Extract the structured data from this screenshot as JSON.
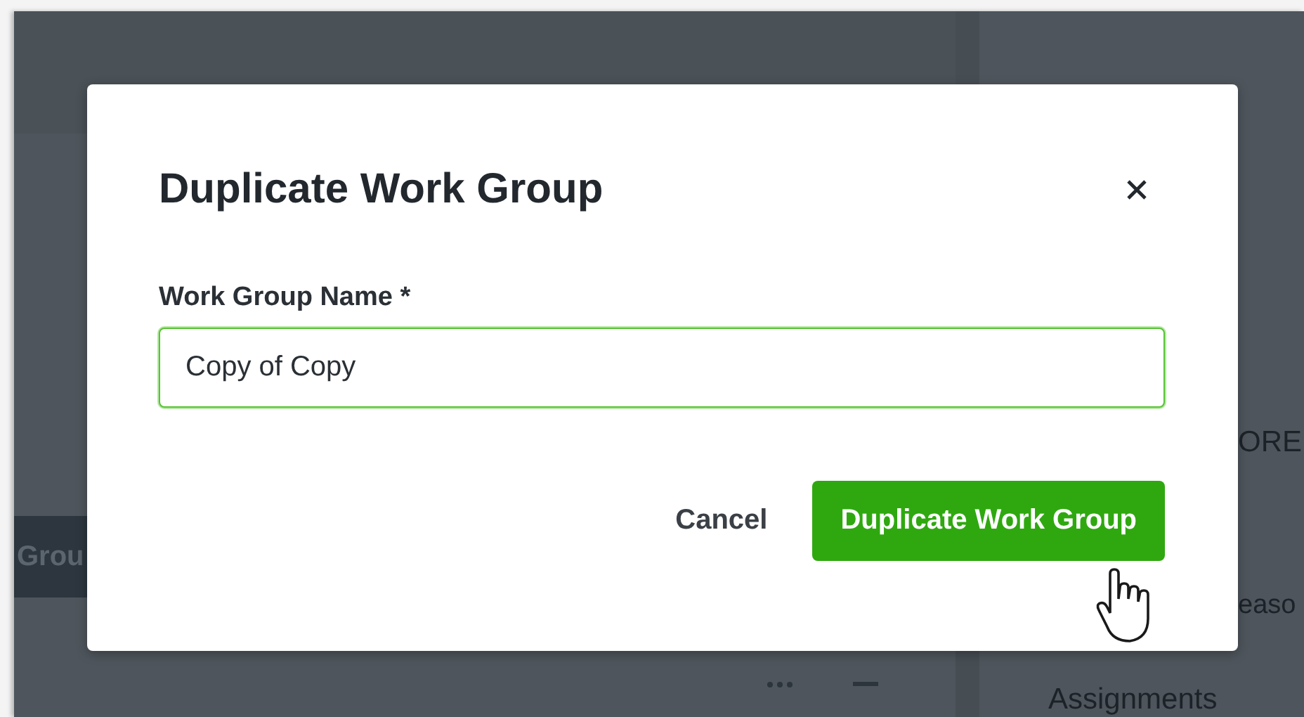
{
  "background": {
    "group_tab": "Grou",
    "more_link": "ORE",
    "reason_label": "easo",
    "assignments_heading": "Assignments"
  },
  "dialog": {
    "title": "Duplicate Work Group",
    "field": {
      "label": "Work Group Name *",
      "value": "Copy of Copy",
      "focused": true
    },
    "buttons": [
      {
        "label": "Cancel",
        "kind": "text"
      },
      {
        "label": "Duplicate Work Group",
        "kind": "primary"
      }
    ]
  }
}
